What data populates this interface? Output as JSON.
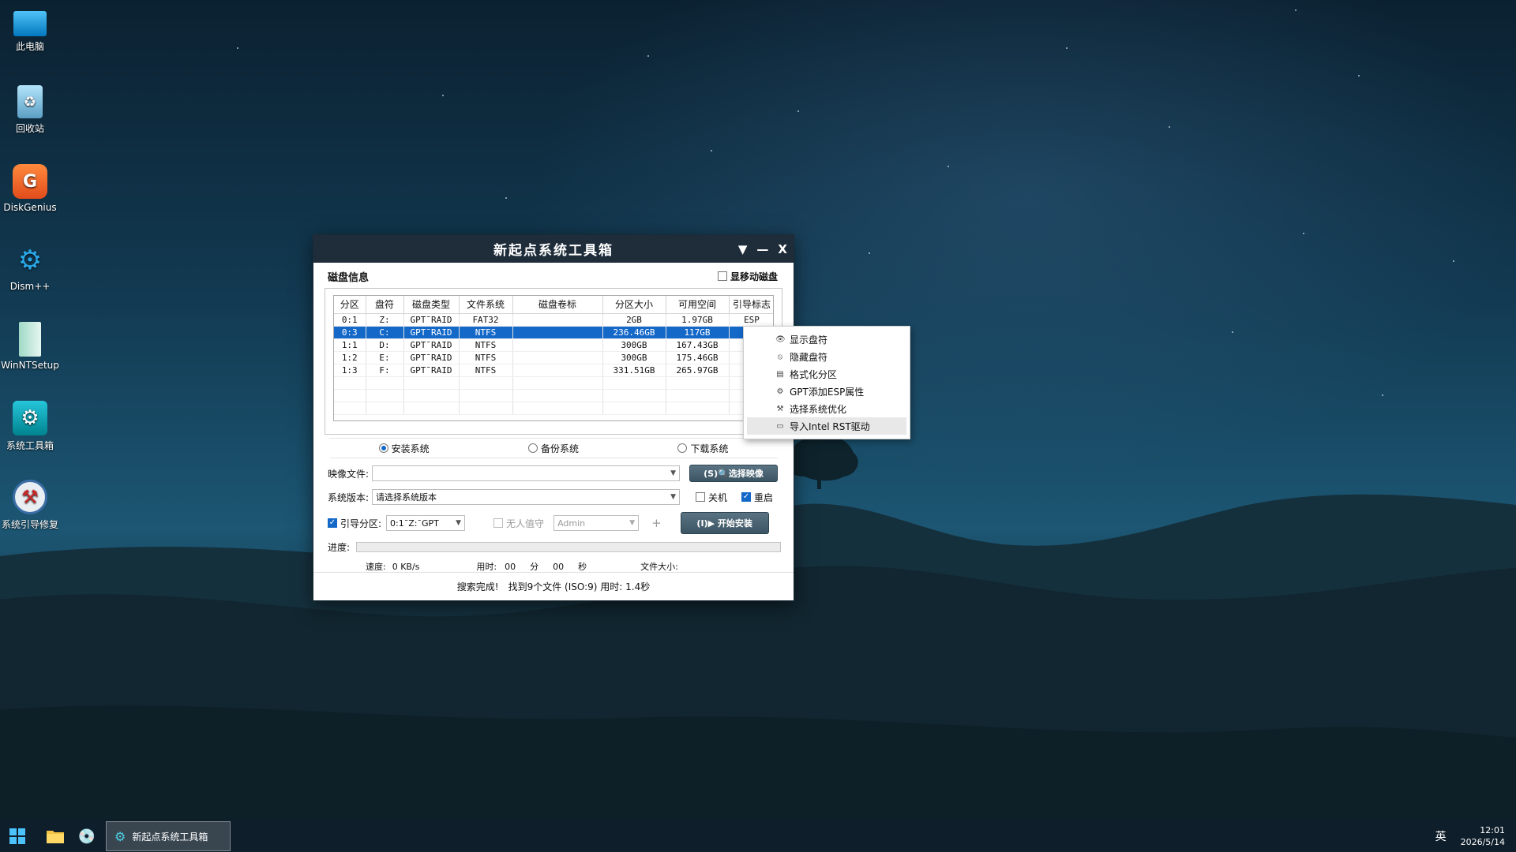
{
  "desktop_icons": [
    {
      "label": "此电脑",
      "icon": "computer-icon"
    },
    {
      "label": "回收站",
      "icon": "recycle-bin-icon"
    },
    {
      "label": "DiskGenius",
      "icon": "diskgenius-icon"
    },
    {
      "label": "Dism++",
      "icon": "gears-icon"
    },
    {
      "label": "WinNTSetup",
      "icon": "setup-icon"
    },
    {
      "label": "系统工具箱",
      "icon": "toolbox-icon"
    },
    {
      "label": "系统引导修复",
      "icon": "boot-repair-icon"
    }
  ],
  "window": {
    "title": "新起点系统工具箱",
    "menu_glyph": "▼",
    "min_glyph": "—",
    "close_glyph": "X",
    "disk_info_label": "磁盘信息",
    "show_removable_label": "显移动磁盘",
    "show_removable_checked": false
  },
  "disk_table": {
    "headers": [
      "分区",
      "盘符",
      "磁盘类型",
      "文件系统",
      "磁盘卷标",
      "分区大小",
      "可用空间",
      "引导标志"
    ],
    "rows": [
      [
        "0:1",
        "Z:",
        "GPT¯RAID",
        "FAT32",
        "",
        "2GB",
        "1.97GB",
        "ESP"
      ],
      [
        "0:3",
        "C:",
        "GPT¯RAID",
        "NTFS",
        "",
        "236.46GB",
        "117GB",
        ""
      ],
      [
        "1:1",
        "D:",
        "GPT¯RAID",
        "NTFS",
        "",
        "300GB",
        "167.43GB",
        ""
      ],
      [
        "1:2",
        "E:",
        "GPT¯RAID",
        "NTFS",
        "",
        "300GB",
        "175.46GB",
        ""
      ],
      [
        "1:3",
        "F:",
        "GPT¯RAID",
        "NTFS",
        "",
        "331.51GB",
        "265.97GB",
        ""
      ]
    ],
    "selected_row": 1
  },
  "modes": {
    "install": "安装系统",
    "backup": "备份系统",
    "download": "下载系统",
    "selected": "install"
  },
  "form": {
    "image_label": "映像文件:",
    "image_value": "",
    "select_image_btn": "(S)🔍选择映像",
    "version_label": "系统版本:",
    "version_value": "请选择系统版本",
    "shutdown_label": "关机",
    "shutdown_checked": false,
    "restart_label": "重启",
    "restart_checked": true,
    "boot_label": "引导分区:",
    "boot_checked": true,
    "boot_value": "0:1¯Z:¯GPT",
    "unattended_label": "无人值守",
    "unattended_checked": false,
    "user_value": "Admin",
    "plus": "+",
    "install_btn": "(I)▶ 开始安装",
    "progress_label": "进度:",
    "progress": 0
  },
  "stats": {
    "speed_label": "速度:",
    "speed_value": "0 KB/s",
    "time_label": "用时:",
    "min_value": "00",
    "min_unit": "分",
    "sec_value": "00",
    "sec_unit": "秒",
    "size_label": "文件大小:"
  },
  "status": {
    "done": "搜索完成!",
    "found": "找到9个文件 (ISO:9) 用时: 1.4秒"
  },
  "context_menu": [
    {
      "label": "显示盘符",
      "icon": "eye-icon",
      "glyph": "👁"
    },
    {
      "label": "隐藏盘符",
      "icon": "hide-icon",
      "glyph": "⦸"
    },
    {
      "label": "格式化分区",
      "icon": "format-icon",
      "glyph": "▤"
    },
    {
      "label": "GPT添加ESP属性",
      "icon": "gear-icon",
      "glyph": "⚙"
    },
    {
      "label": "选择系统优化",
      "icon": "wrench-icon",
      "glyph": "⚒"
    },
    {
      "label": "导入Intel RST驱动",
      "icon": "folder-icon",
      "glyph": "▭"
    }
  ],
  "context_menu_highlight": 5,
  "taskbar": {
    "app_label": "新起点系统工具箱",
    "ime": "英",
    "time": "12:01",
    "date": "2026/5/14"
  }
}
